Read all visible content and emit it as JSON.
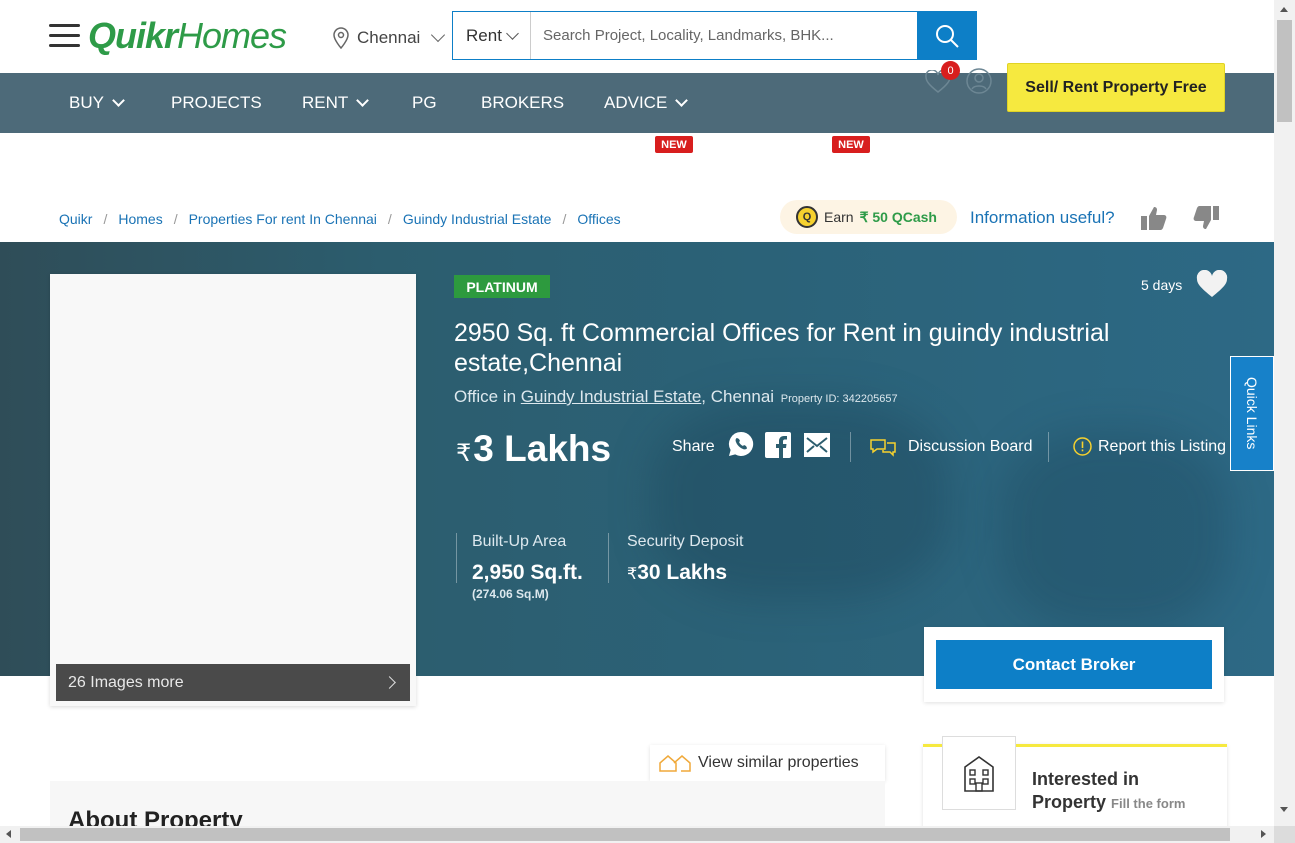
{
  "header": {
    "logo_part1": "Quikr",
    "logo_part2": "Homes",
    "city": "Chennai",
    "search_type": "Rent",
    "search_placeholder": "Search Project, Locality, Landmarks, BHK..."
  },
  "nav": {
    "items": [
      {
        "label": "BUY",
        "dropdown": true
      },
      {
        "label": "PROJECTS",
        "dropdown": false
      },
      {
        "label": "RENT",
        "dropdown": true
      },
      {
        "label": "PG",
        "dropdown": false
      },
      {
        "label": "BROKERS",
        "dropdown": false
      },
      {
        "label": "ADVICE",
        "dropdown": true
      }
    ],
    "new_badge": "NEW",
    "wishlist_count": "0",
    "sell_button": "Sell/ Rent Property Free"
  },
  "breadcrumb": [
    "Quikr",
    "Homes",
    "Properties For rent In Chennai",
    "Guindy Industrial Estate",
    "Offices"
  ],
  "qcash": {
    "coin": "Q",
    "earn_label": "Earn",
    "amount": "₹ 50 QCash"
  },
  "feedback": {
    "question": "Information useful?"
  },
  "listing": {
    "tier": "PLATINUM",
    "age": "5 days",
    "title": "2950 Sq. ft Commercial Offices for Rent in guindy industrial estate,Chennai",
    "type_prefix": "Office in",
    "locality": "Guindy Industrial Estate",
    "city_suffix": ", Chennai",
    "property_id": "Property ID: 342205657",
    "currency": "₹",
    "price": "3 Lakhs",
    "images_more": "26 Images more",
    "share_label": "Share",
    "discussion": "Discussion Board",
    "report": "Report this Listing",
    "quick_links": "Quick Links",
    "built_up_label": "Built-Up Area",
    "built_up_value": "2,950 Sq.ft.",
    "built_up_sub": "(274.06 Sq.M)",
    "deposit_label": "Security Deposit",
    "deposit_value": "30 Lakhs",
    "contact_button": "Contact Broker"
  },
  "below": {
    "view_similar": "View similar properties",
    "about_heading": "About Property",
    "interested_line1": "Interested in",
    "interested_line2": "Property",
    "interested_small": "Fill the form"
  },
  "colors": {
    "brand_green": "#2e9b48",
    "primary_blue": "#0d7fc7",
    "nav_bg": "#4d6a79",
    "sell_yellow": "#f6e93f",
    "new_red": "#d81e1e"
  }
}
